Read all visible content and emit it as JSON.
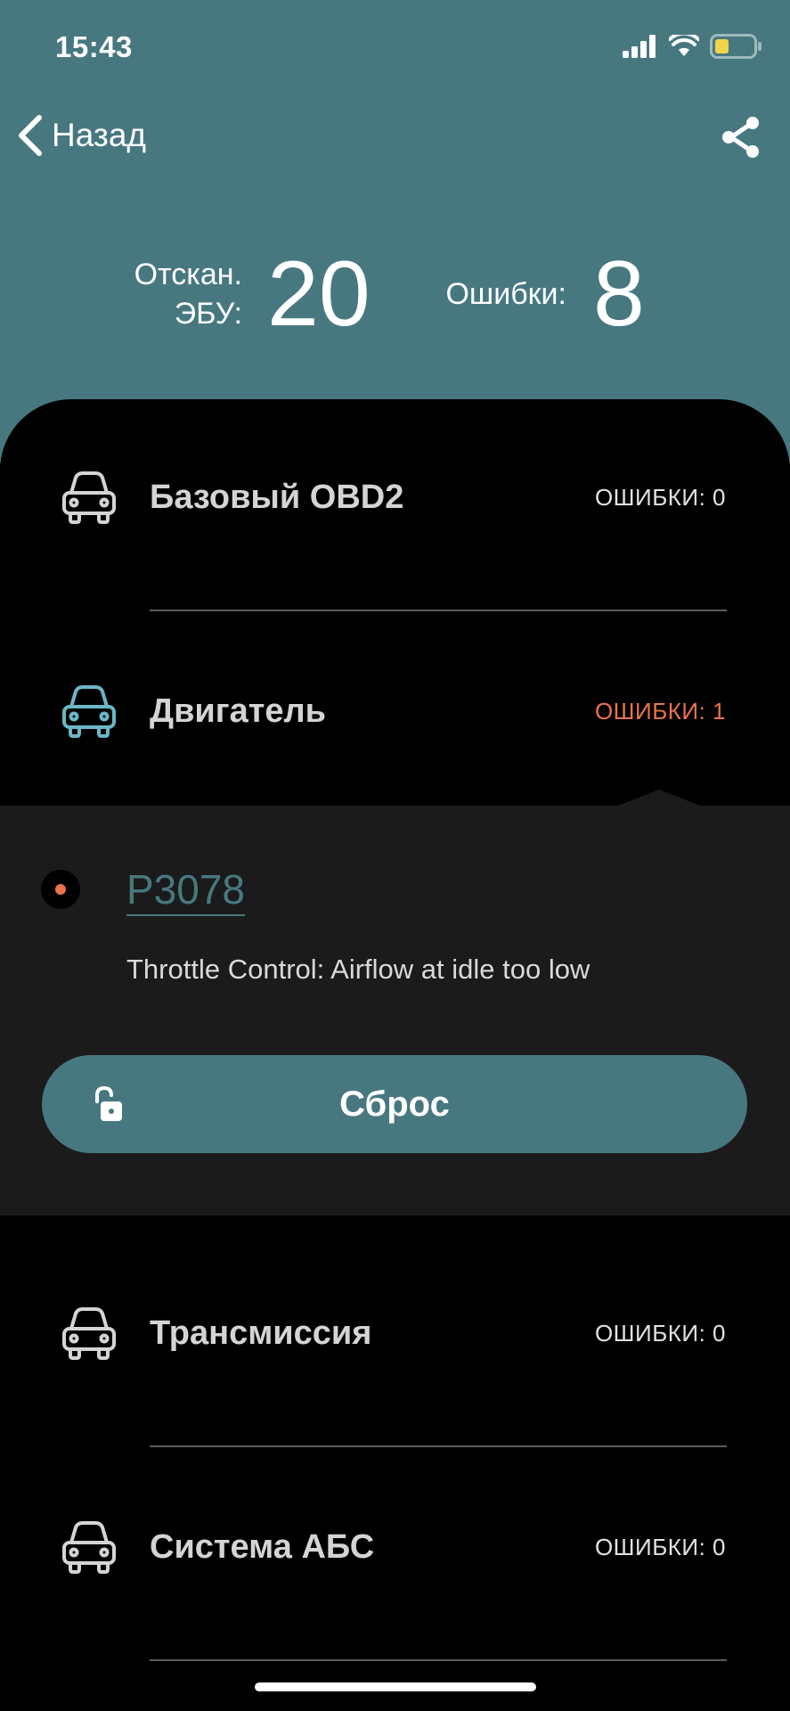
{
  "status_bar": {
    "time": "15:43"
  },
  "nav": {
    "back_label": "Назад"
  },
  "summary": {
    "scanned_label_line1": "Отскан.",
    "scanned_label_line2": "ЭБУ:",
    "scanned_value": "20",
    "errors_label": "Ошибки:",
    "errors_value": "8"
  },
  "colors": {
    "accent": "#477880",
    "error": "#e9734e",
    "active_icon": "#6bb7c7"
  },
  "modules": [
    {
      "name": "Базовый OBD2",
      "count": "ОШИБКИ: 0",
      "icon": "car-icon"
    },
    {
      "name": "Двигатель",
      "count": "ОШИБКИ: 1",
      "icon": "car-icon"
    },
    {
      "name": "Трансмиссия",
      "count": "ОШИБКИ: 0",
      "icon": "car-icon"
    },
    {
      "name": "Система АБС",
      "count": "ОШИБКИ: 0",
      "icon": "car-icon"
    }
  ],
  "error_detail": {
    "code": "P3078",
    "description": "Throttle Control: Airflow at idle too low",
    "reset_label": "Сброс"
  }
}
